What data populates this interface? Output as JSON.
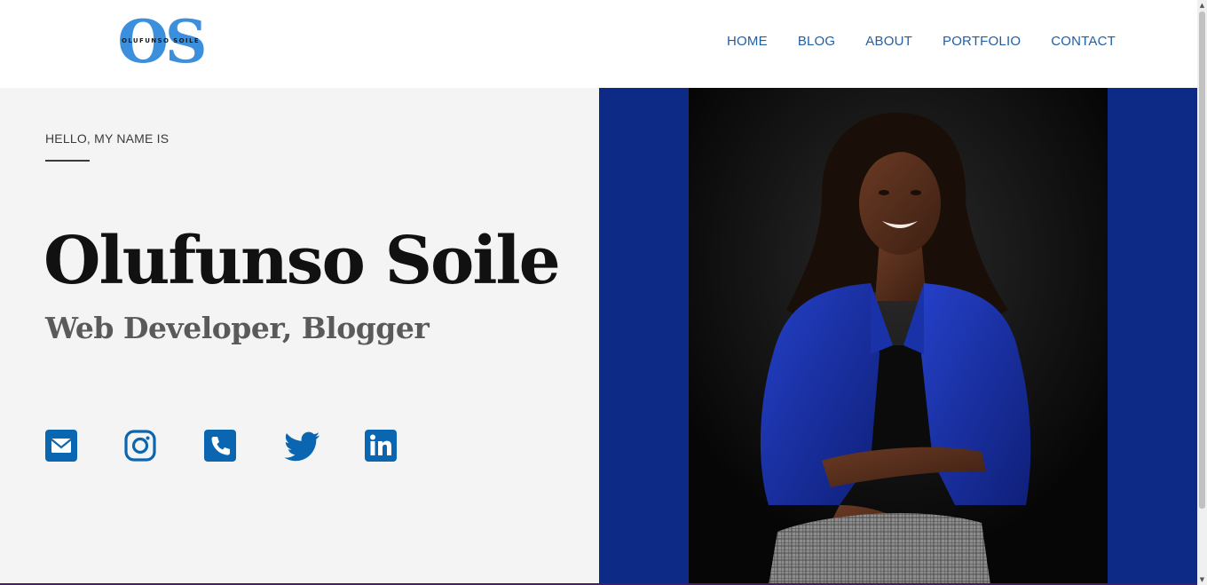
{
  "brand": {
    "monogram": "OS",
    "name": "OLUFUNSO SOILE"
  },
  "nav": {
    "items": [
      "HOME",
      "BLOG",
      "ABOUT",
      "PORTFOLIO",
      "CONTACT"
    ]
  },
  "hero": {
    "greeting": "HELLO, MY NAME IS",
    "name": "Olufunso Soile",
    "role": "Web Developer, Blogger"
  },
  "socials": [
    {
      "icon": "envelope-icon"
    },
    {
      "icon": "instagram-icon"
    },
    {
      "icon": "phone-icon"
    },
    {
      "icon": "twitter-icon"
    },
    {
      "icon": "linkedin-icon"
    }
  ],
  "colors": {
    "brand_blue": "#3b8fdc",
    "nav_text": "#1f5fa8",
    "social_blue": "#0a66b0",
    "hero_left_bg": "#f4f4f4",
    "hero_right_bg": "#0d2a86",
    "name_text": "#111111",
    "role_text": "#5a5a5a"
  },
  "photo": {
    "subject": "portrait-photo"
  }
}
